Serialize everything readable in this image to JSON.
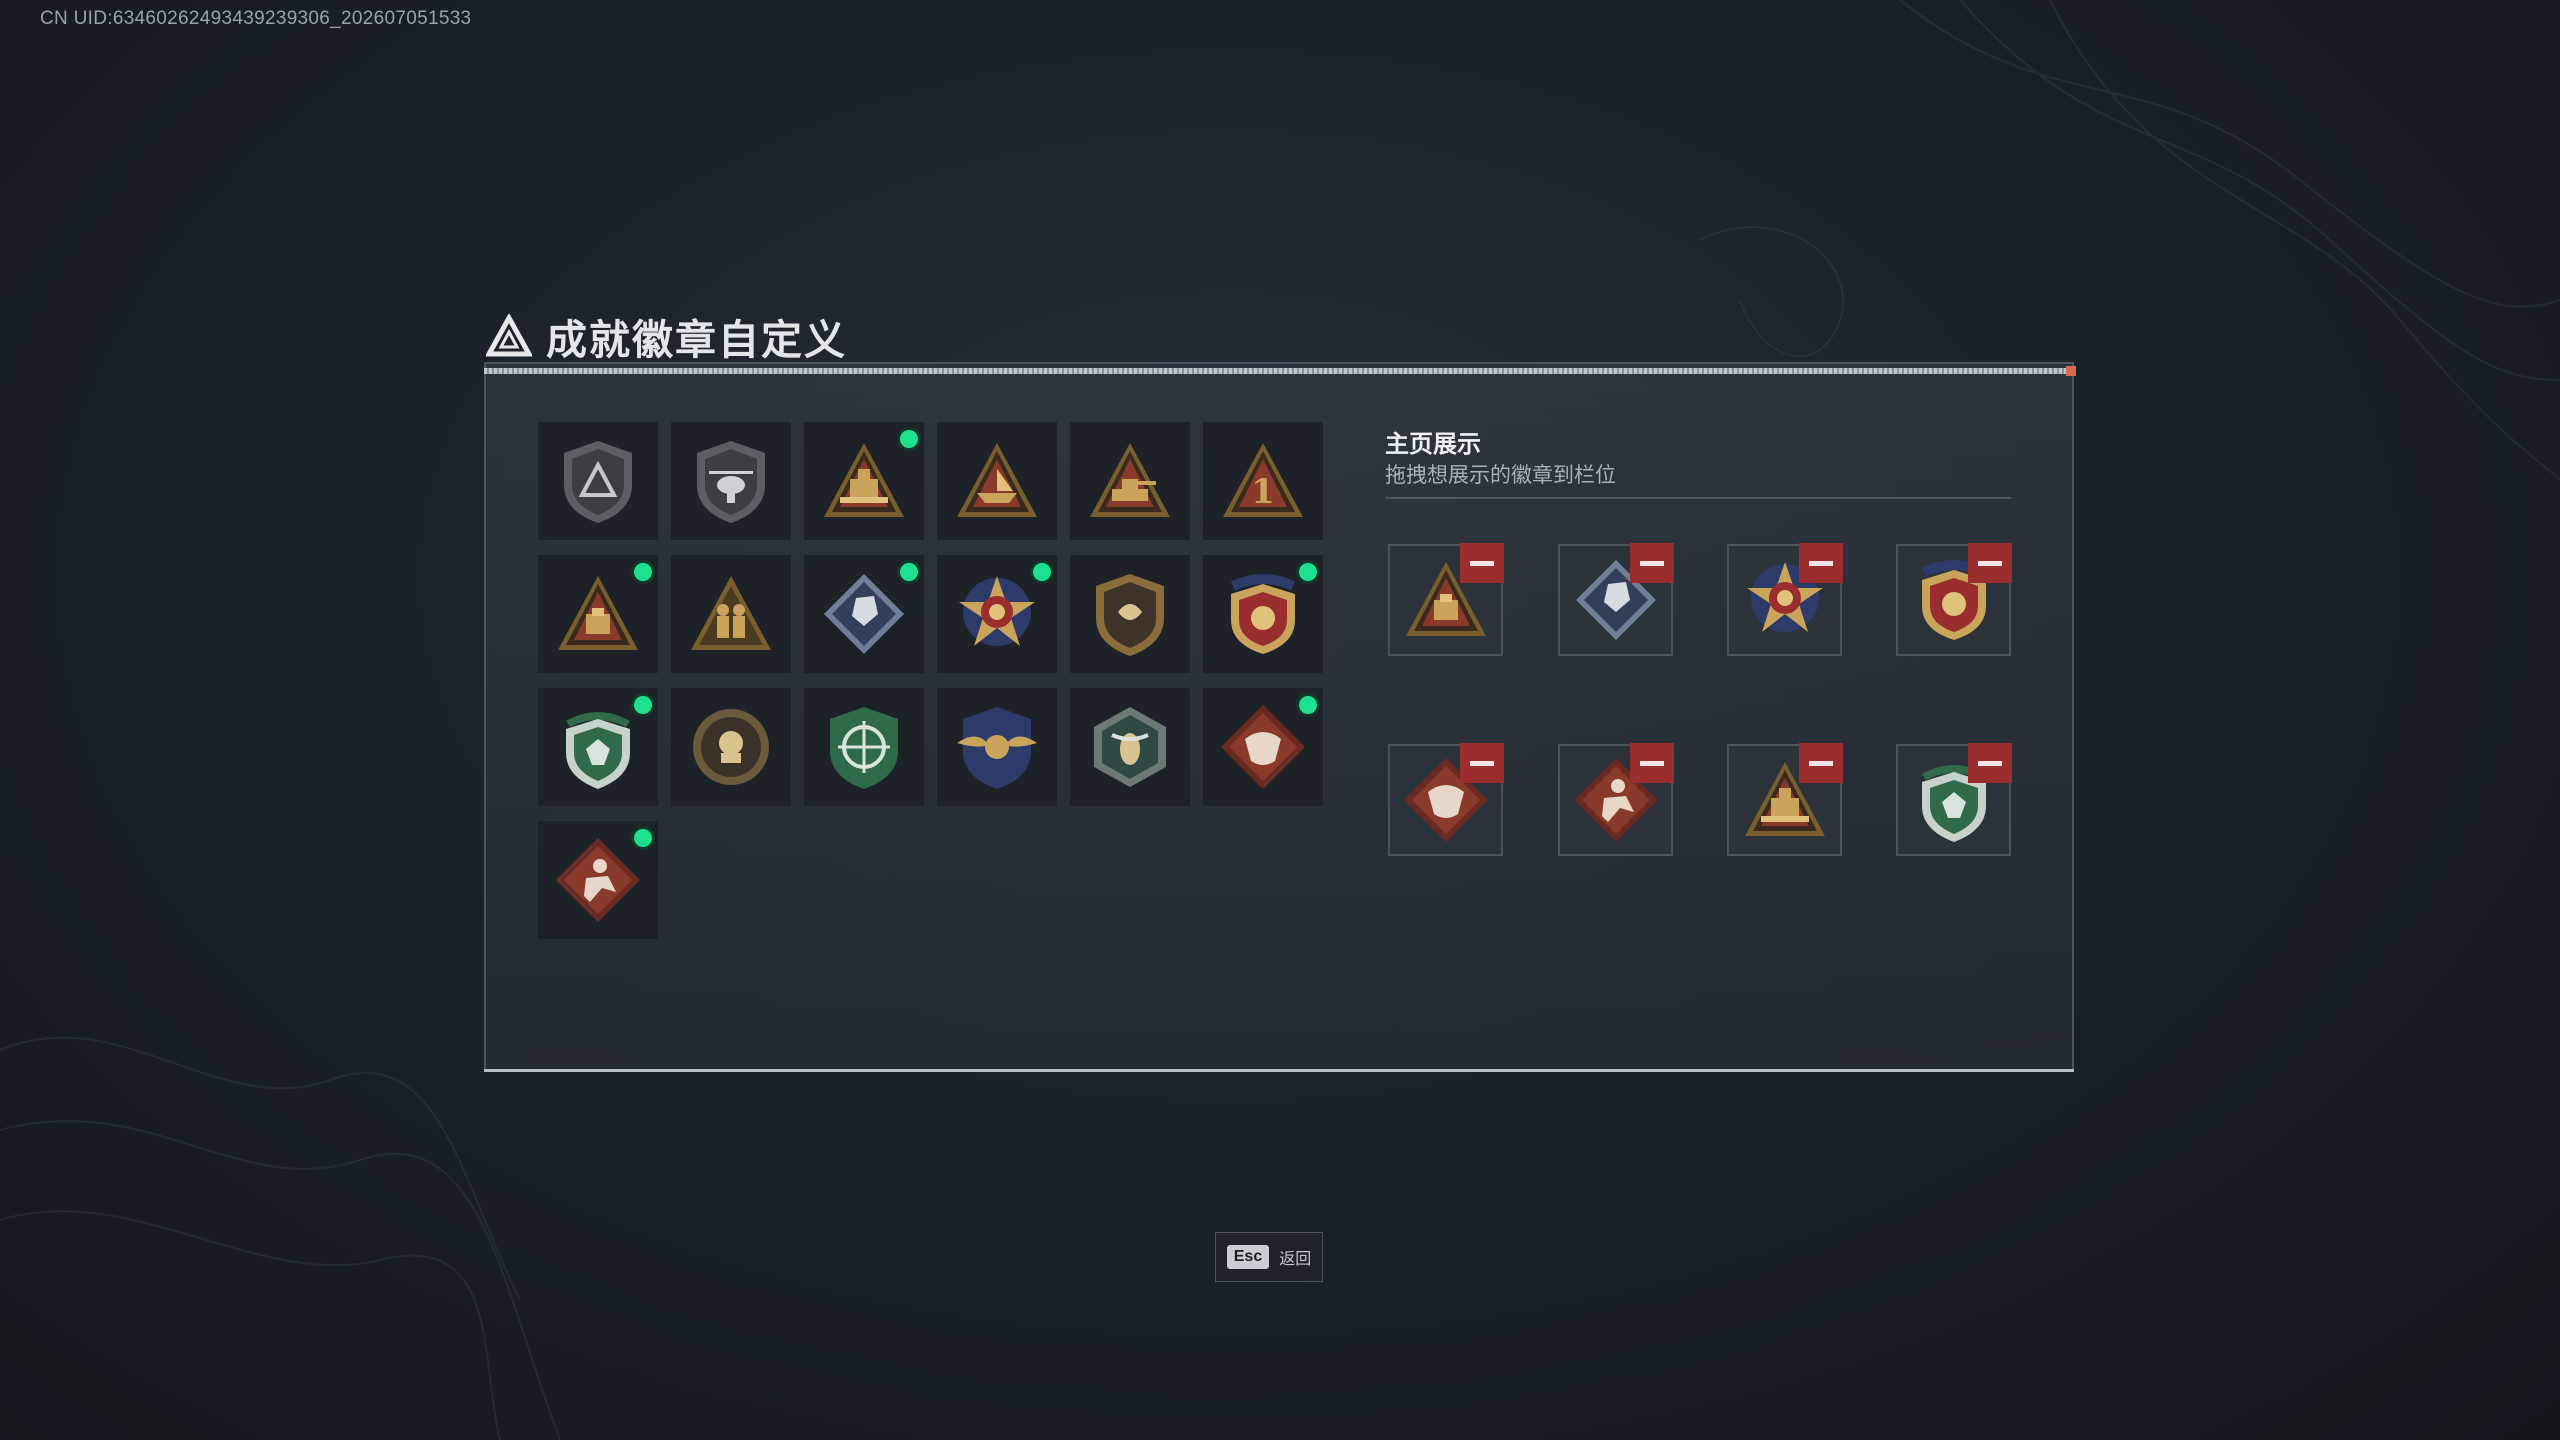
{
  "uid_text": "CN UID:6346026249343923​9306_202607051533",
  "title": "成就徽章自定义",
  "title_tag": "",
  "showcase": {
    "title": "主页展示",
    "subtitle": "拖拽想展示的徽章到栏位"
  },
  "esc": {
    "key": "Esc",
    "label": "返回"
  },
  "colors": {
    "new_dot": "#1fe08e",
    "remove": "#9a2e2e",
    "gold": "#c9a45a"
  },
  "badges": [
    {
      "icon": "triangle-emblem-shield-badge-icon",
      "style": "shield-gray",
      "new": false
    },
    {
      "icon": "helicopter-shield-badge-icon",
      "style": "shield-gray-heli",
      "new": false
    },
    {
      "icon": "gold-fortress-triangle-badge-icon",
      "style": "tri-fortress",
      "new": true
    },
    {
      "icon": "boat-triangle-badge-icon",
      "style": "tri-boat",
      "new": false
    },
    {
      "icon": "tank-triangle-badge-icon",
      "style": "tri-tank",
      "new": false
    },
    {
      "icon": "number-one-triangle-badge-icon",
      "style": "tri-one",
      "new": false
    },
    {
      "icon": "supply-crate-triangle-badge-icon",
      "style": "tri-crate",
      "new": true
    },
    {
      "icon": "soldiers-triangle-badge-icon",
      "style": "tri-soldiers",
      "new": false
    },
    {
      "icon": "blue-cube-diamond-badge-icon",
      "style": "diamond-blue",
      "new": true
    },
    {
      "icon": "red-star-medal-badge-icon",
      "style": "star-medal",
      "new": true
    },
    {
      "icon": "crest-shield-badge-icon",
      "style": "shield-crest",
      "new": false
    },
    {
      "icon": "red-gold-stars-shield-badge-icon",
      "style": "shield-redgold",
      "new": true
    },
    {
      "icon": "green-beret-shield-badge-icon",
      "style": "shield-green",
      "new": true
    },
    {
      "icon": "coin-skull-badge-icon",
      "style": "coin",
      "new": false
    },
    {
      "icon": "green-crosshair-shield-badge-icon",
      "style": "shield-crosshair",
      "new": false
    },
    {
      "icon": "gold-wings-shield-badge-icon",
      "style": "shield-wings",
      "new": false
    },
    {
      "icon": "hornet-hexagon-badge-icon",
      "style": "hex-hornet",
      "new": false
    },
    {
      "icon": "dragon-diamond-badge-icon",
      "style": "diamond-dragon",
      "new": true
    },
    {
      "icon": "runner-diamond-badge-icon",
      "style": "diamond-runner",
      "new": true
    }
  ],
  "showcase_slots": [
    {
      "icon": "supply-crate-triangle-badge-icon",
      "style": "tri-crate"
    },
    {
      "icon": "blue-cube-diamond-badge-icon",
      "style": "diamond-blue"
    },
    {
      "icon": "red-star-medal-badge-icon",
      "style": "star-medal"
    },
    {
      "icon": "red-gold-stars-shield-badge-icon",
      "style": "shield-redgold"
    },
    {
      "icon": "dragon-diamond-badge-icon",
      "style": "diamond-dragon"
    },
    {
      "icon": "runner-diamond-badge-icon",
      "style": "diamond-runner"
    },
    {
      "icon": "gold-fortress-triangle-badge-icon",
      "style": "tri-fortress"
    },
    {
      "icon": "green-beret-shield-badge-icon",
      "style": "shield-green"
    }
  ]
}
